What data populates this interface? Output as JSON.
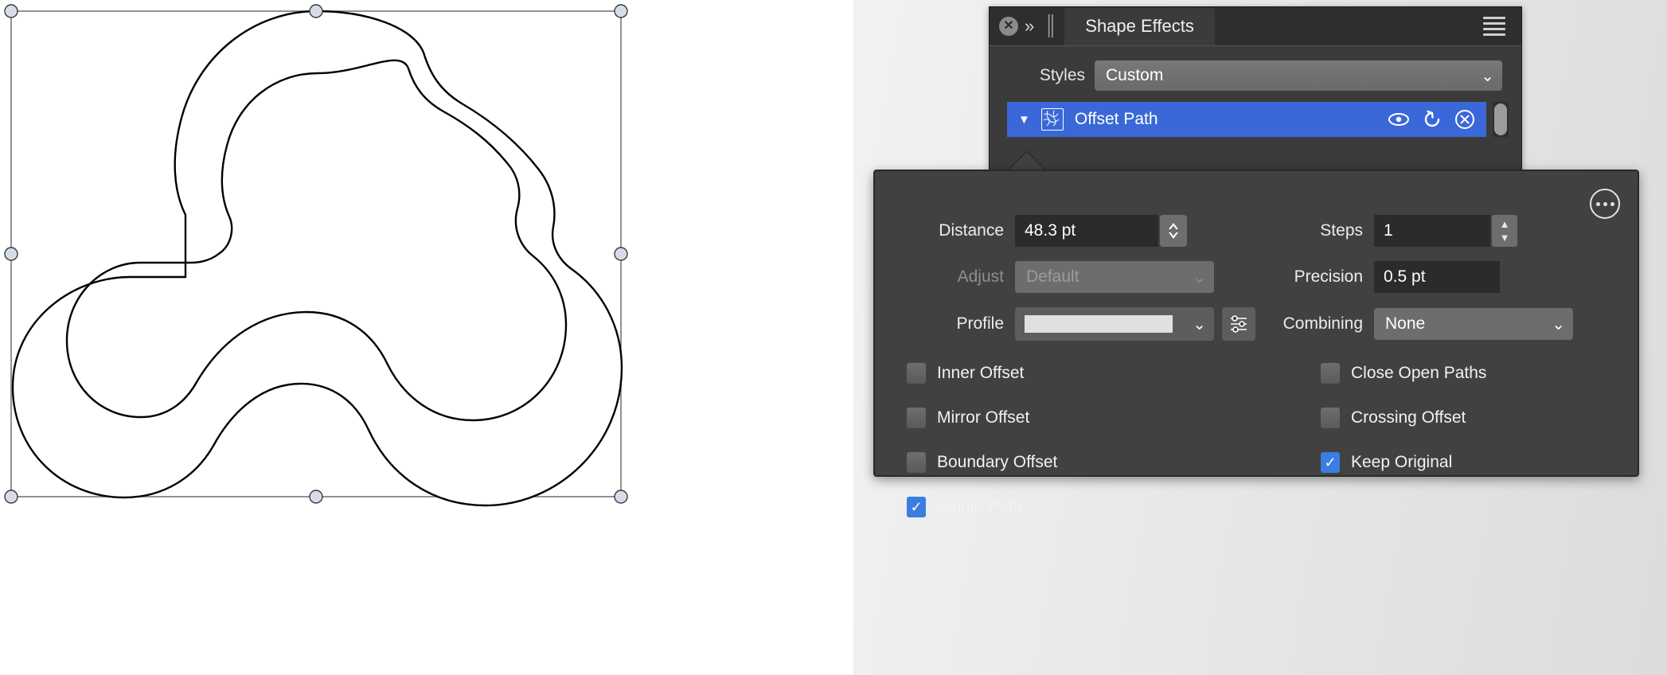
{
  "canvas": {
    "name": "artboard",
    "shape_name": "offset-path-blob",
    "selection_handles": 8,
    "stroke_color": "#000000",
    "fill_color": "#ffffff",
    "handle_fill": "#d6dce8",
    "bbox_stroke": "#6e6e6e"
  },
  "panel": {
    "tab_label": "Shape Effects",
    "close_icon": "close-circle-icon",
    "collapse_icon": "double-chevron-right-icon",
    "grip_icon": "drag-grip-icon",
    "menu_icon": "hamburger-menu-icon",
    "styles": {
      "label": "Styles",
      "value": "Custom",
      "chevron": "chevron-down-icon"
    },
    "effect": {
      "disclosure": "triangle-down-icon",
      "thumbnail": "offset-path-thumbnail-icon",
      "name": "Offset Path",
      "visibility_icon": "eye-icon",
      "reset_icon": "reset-arrow-icon",
      "delete_icon": "close-circle-outline-icon",
      "selected_color": "#3b68d8"
    },
    "scrollbar": "panel-scrollbar"
  },
  "popover": {
    "options_icon": "more-options-circle-icon",
    "distance": {
      "label": "Distance",
      "value": "48.3 pt",
      "stepper": "stepper-updown-icon"
    },
    "steps": {
      "label": "Steps",
      "value": "1",
      "stepper": "stepper-updown-split-icon"
    },
    "adjust": {
      "label": "Adjust",
      "value": "Default",
      "disabled": true,
      "chevron": "chevron-down-icon"
    },
    "precision": {
      "label": "Precision",
      "value": "0.5 pt"
    },
    "profile": {
      "label": "Profile",
      "value": "",
      "chevron": "chevron-down-icon",
      "settings_icon": "sliders-icon"
    },
    "combining": {
      "label": "Combining",
      "value": "None",
      "chevron": "chevron-down-icon"
    },
    "checkboxes": [
      {
        "label": "Inner Offset",
        "checked": false,
        "column": "left"
      },
      {
        "label": "Close Open Paths",
        "checked": false,
        "column": "right"
      },
      {
        "label": "Mirror Offset",
        "checked": false,
        "column": "left"
      },
      {
        "label": "Crossing Offset",
        "checked": false,
        "column": "right"
      },
      {
        "label": "Boundary Offset",
        "checked": false,
        "column": "left"
      },
      {
        "label": "Keep Original",
        "checked": true,
        "column": "right"
      },
      {
        "label": "Single Path",
        "checked": true,
        "column": "left"
      }
    ],
    "checkbox_on_color": "#3b7de0",
    "check_glyph": "✓"
  }
}
